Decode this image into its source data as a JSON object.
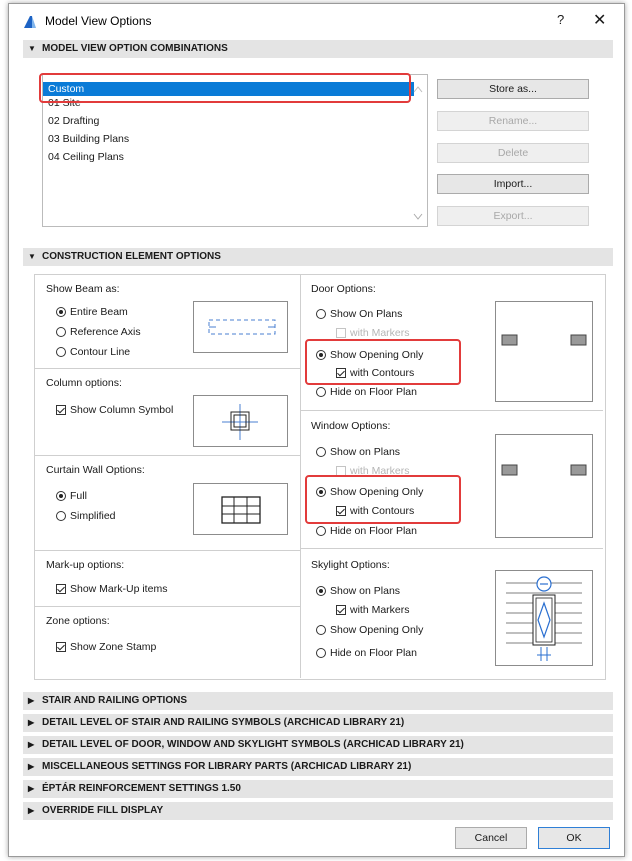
{
  "window": {
    "title": "Model View Options",
    "help_label": "?",
    "close_label": "✕"
  },
  "combinations": {
    "header": "MODEL VIEW OPTION COMBINATIONS",
    "items": [
      "Custom",
      "01 Site",
      "02 Drafting",
      "03 Building Plans",
      "04 Ceiling Plans"
    ],
    "selected": "Custom",
    "buttons": {
      "store": "Store as...",
      "rename": "Rename...",
      "delete": "Delete",
      "import": "Import...",
      "export": "Export..."
    }
  },
  "construction": {
    "header": "CONSTRUCTION ELEMENT OPTIONS",
    "beam": {
      "title": "Show Beam as:",
      "options": [
        "Entire Beam",
        "Reference Axis",
        "Contour Line"
      ],
      "selected": "Entire Beam"
    },
    "column": {
      "title": "Column options:",
      "show_symbol": "Show Column Symbol",
      "show_symbol_checked": true
    },
    "curtain_wall": {
      "title": "Curtain Wall Options:",
      "options": [
        "Full",
        "Simplified"
      ],
      "selected": "Full"
    },
    "markup": {
      "title": "Mark-up options:",
      "show_items": "Show Mark-Up items",
      "show_items_checked": true
    },
    "zone": {
      "title": "Zone options:",
      "show_stamp": "Show Zone Stamp",
      "show_stamp_checked": true
    },
    "door": {
      "title": "Door Options:",
      "show_on_plans": "Show On Plans",
      "with_markers": "with Markers",
      "show_opening_only": "Show Opening Only",
      "with_contours": "with Contours",
      "hide_on_floor_plan": "Hide on Floor Plan",
      "selected": "Show Opening Only",
      "with_contours_checked": true
    },
    "window": {
      "title": "Window Options:",
      "show_on_plans": "Show on Plans",
      "with_markers": "with Markers",
      "show_opening_only": "Show Opening Only",
      "with_contours": "with Contours",
      "hide_on_floor_plan": "Hide on Floor Plan",
      "selected": "Show Opening Only",
      "with_contours_checked": true
    },
    "skylight": {
      "title": "Skylight Options:",
      "show_on_plans": "Show on Plans",
      "with_markers": "with Markers",
      "show_opening_only": "Show Opening Only",
      "hide_on_floor_plan": "Hide on Floor Plan",
      "selected": "Show on Plans",
      "with_markers_checked": true
    }
  },
  "collapsed_sections": [
    "STAIR AND RAILING OPTIONS",
    "DETAIL LEVEL OF STAIR AND RAILING SYMBOLS (ARCHICAD LIBRARY 21)",
    "DETAIL LEVEL OF DOOR, WINDOW AND SKYLIGHT SYMBOLS (ARCHICAD LIBRARY 21)",
    "MISCELLANEOUS SETTINGS FOR LIBRARY PARTS (ARCHICAD LIBRARY 21)",
    "ÉPTÁR REINFORCEMENT SETTINGS 1.50",
    "OVERRIDE FILL DISPLAY"
  ],
  "footer": {
    "cancel": "Cancel",
    "ok": "OK"
  },
  "colors": {
    "selection": "#0a7bd7",
    "highlight": "#e23b3b",
    "section_bar": "#e4e4e4",
    "ok_border": "#2f7fd6"
  }
}
